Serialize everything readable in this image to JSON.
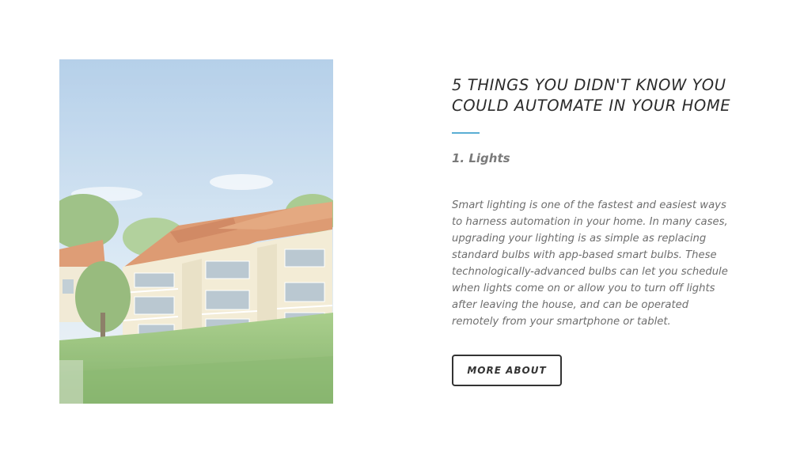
{
  "article": {
    "title": "5 THINGS YOU DIDN'T KNOW YOU COULD AUTOMATE IN YOUR HOME",
    "section_heading": "1. Lights",
    "body": "Smart lighting is one of the fastest and easiest ways to harness automation in your home. In many cases, upgrading your lighting is as simple as replacing standard bulbs with app-based smart bulbs. These technologically-advanced bulbs can let you schedule when lights come on or allow you to turn off lights after leaving the house, and can be operated remotely from your smartphone or tablet.",
    "button_label": "MORE ABOUT"
  },
  "colors": {
    "accent": "#5aaed4",
    "title_text": "#2b2b2b",
    "body_text": "#6e6e6e",
    "button_border": "#333333"
  }
}
